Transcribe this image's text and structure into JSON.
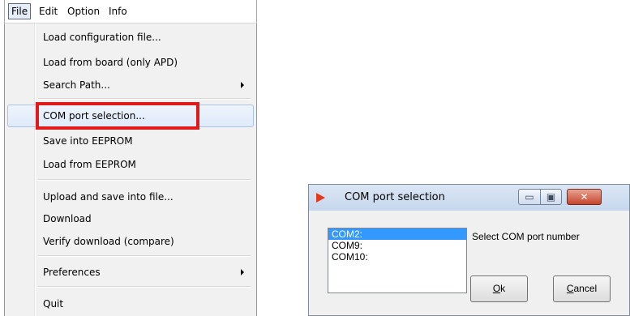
{
  "menubar": {
    "items": [
      {
        "label": "File"
      },
      {
        "label": "Edit"
      },
      {
        "label": "Option"
      },
      {
        "label": "Info"
      }
    ]
  },
  "file_menu": {
    "items": [
      {
        "label": "Load configuration file..."
      },
      {
        "label": "Load from board (only APD)"
      },
      {
        "label": "Search Path...",
        "submenu": true
      },
      {
        "label": "COM port selection..."
      },
      {
        "label": "Save into EEPROM"
      },
      {
        "label": "Load from EEPROM"
      },
      {
        "label": "Upload and save into file..."
      },
      {
        "label": "Download"
      },
      {
        "label": "Verify download (compare)"
      },
      {
        "label": "Preferences",
        "submenu": true
      },
      {
        "label": "Quit"
      }
    ],
    "highlight_color": "#e01a1a"
  },
  "dialog": {
    "title": "COM port selection",
    "ports": [
      "COM2:",
      "COM9:",
      "COM10:"
    ],
    "selected_port": "COM2:",
    "prompt": "Select COM port number",
    "ok_mnemonic": "O",
    "ok_rest": "k",
    "cancel_mnemonic": "C",
    "cancel_rest": "ancel",
    "minimize_glyph": "▭",
    "maximize_glyph": "▣",
    "close_glyph": "✕"
  }
}
